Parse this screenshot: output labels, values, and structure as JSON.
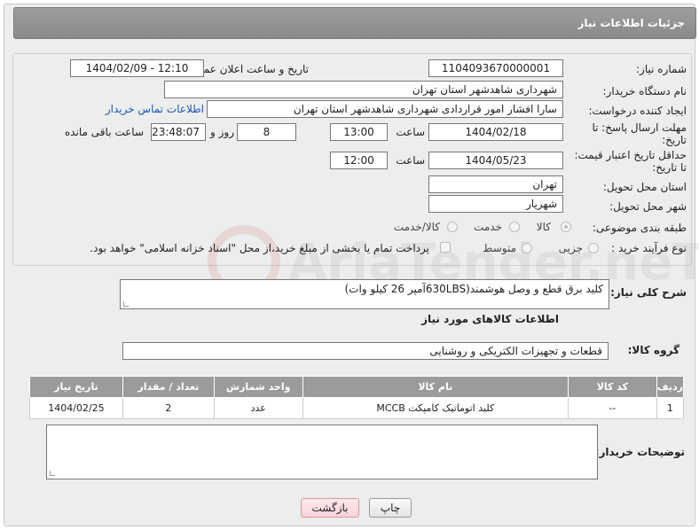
{
  "header": {
    "title": "جزئیات اطلاعات نیاز"
  },
  "form": {
    "need_number_label": "شماره نیاز:",
    "need_number": "1104093670000001",
    "announce_label": "تاریخ و ساعت اعلان عمومی:",
    "announce_value": "1404/02/09 - 12:10",
    "buyer_org_label": "نام دستگاه خریدار:",
    "buyer_org": "شهرداری شاهدشهر استان تهران",
    "creator_label": "ایجاد کننده درخواست:",
    "creator": "سارا افشار امور قراردادی شهرداری شاهدشهر استان تهران",
    "contact_link": "اطلاعات تماس خریدار",
    "reply_deadline_label_1": "مهلت ارسال پاسخ: تا",
    "reply_deadline_label_2": "تاریخ:",
    "reply_date": "1404/02/18",
    "time_label": "ساعت",
    "reply_time": "13:00",
    "days_value": "8",
    "days_label": "روز و",
    "remaining_time": "23:48:07",
    "remaining_label": "ساعت باقی مانده",
    "price_validity_label_1": "حداقل تاریخ اعتبار قیمت:",
    "price_validity_label_2": "تا تاریخ:",
    "price_date": "1404/05/23",
    "price_time_label": "ساعت",
    "price_time": "12:00",
    "province_label": "استان محل تحویل:",
    "province": "تهران",
    "city_label": "شهر محل تحویل:",
    "city": "شهریار",
    "category_label": "طبقه بندی موضوعی:",
    "category_options": [
      "کالا",
      "خدمت",
      "کالا/خدمت"
    ],
    "process_label": "نوع فرآیند خرید :",
    "process_options": [
      "جزیی",
      "متوسط"
    ],
    "payment_note": "پرداخت تمام یا بخشی از مبلغ خرید،از محل \"اسناد خزانه اسلامی\" خواهد بود."
  },
  "description": {
    "label": "شرح کلی نیاز:",
    "text": "کلید برق قطع و وصل هوشمند(630LBSآمپر 26 کیلو وات)"
  },
  "goods": {
    "section_title": "اطلاعات کالاهای مورد نیاز",
    "group_label": "گروه کالا:",
    "group_value": "قطعات و تجهیزات الکتریکی و روشنایی",
    "columns": [
      "ردیف",
      "کد کالا",
      "نام کالا",
      "واحد شمارش",
      "تعداد / مقدار",
      "تاریخ نیاز"
    ],
    "rows": [
      [
        "1",
        "--",
        "کلید اتوماتیک کامپکت MCCB",
        "عدد",
        "2",
        "1404/02/25"
      ]
    ]
  },
  "buyer_notes": {
    "label": "توضیحات خریدار:",
    "text": ""
  },
  "buttons": {
    "print": "چاپ",
    "back": "بازگشت"
  },
  "watermark": {
    "text": "AriaTender.neT"
  }
}
